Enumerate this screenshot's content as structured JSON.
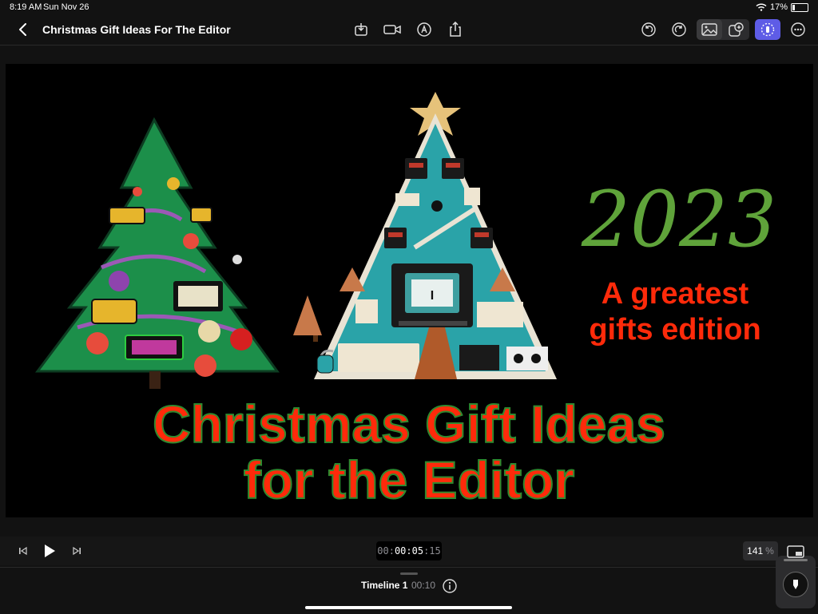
{
  "status_bar": {
    "time": "8:19 AM",
    "date": "Sun Nov 26",
    "battery": "17%",
    "battery_level": 0.17
  },
  "navbar": {
    "title": "Christmas Gift Ideas For The Editor",
    "icons": [
      "back-icon",
      "import-icon",
      "camera-icon",
      "voiceover-icon",
      "share-icon",
      "undo-icon",
      "redo-icon",
      "photo-icon",
      "stickers-icon",
      "inspector-icon",
      "more-icon"
    ],
    "accent_color": "#5e5ce6"
  },
  "viewer": {
    "year": "2023",
    "subtitle_line1": "A greatest",
    "subtitle_line2": "gifts edition",
    "headline_line1": "Christmas Gift Ideas",
    "headline_line2": "for the Editor",
    "monitor_text": "I",
    "colors": {
      "year": "#5fa33a",
      "headline": "#ff2a0a",
      "headline_outline": "#2f8a2f",
      "subtitle": "#ff2a0a"
    }
  },
  "transport": {
    "timecode_prefix": "00:",
    "timecode_main": "00:05",
    "timecode_frames": ":15",
    "zoom_value": "141",
    "zoom_unit": "%"
  },
  "timeline": {
    "name": "Timeline 1",
    "duration": "00:10"
  }
}
